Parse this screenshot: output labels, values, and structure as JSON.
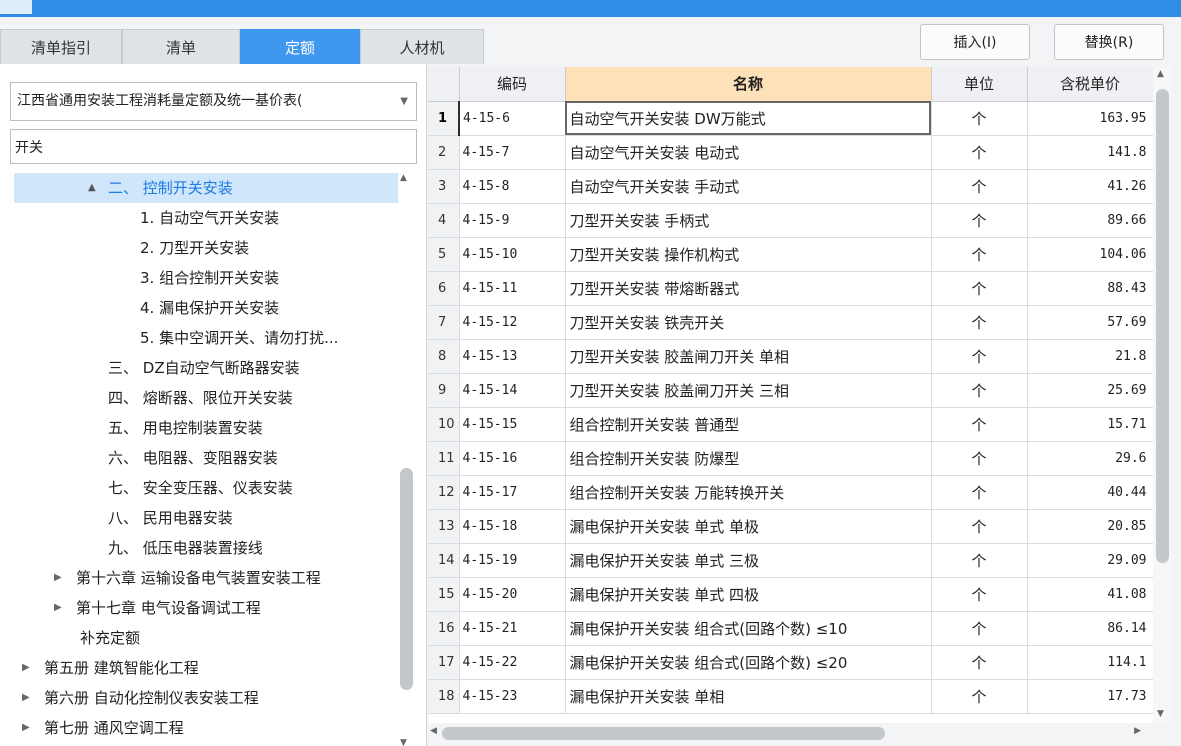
{
  "tabs": [
    "清单指引",
    "清单",
    "定额",
    "人材机"
  ],
  "active_tab": "定额",
  "toolbar": {
    "insert_label": "插入(I)",
    "replace_label": "替换(R)"
  },
  "library_select": "江西省通用安装工程消耗量定额及统一基价表(",
  "search_value": "开关",
  "tree": [
    {
      "label": "二、 控制开关安装",
      "arrow": "▲",
      "selected": true
    },
    {
      "label": "1. 自动空气开关安装"
    },
    {
      "label": "2. 刀型开关安装"
    },
    {
      "label": "3. 组合控制开关安装"
    },
    {
      "label": "4. 漏电保护开关安装"
    },
    {
      "label": "5. 集中空调开关、请勿打扰..."
    },
    {
      "label": "三、 DZ自动空气断路器安装"
    },
    {
      "label": "四、 熔断器、限位开关安装"
    },
    {
      "label": "五、 用电控制装置安装"
    },
    {
      "label": "六、 电阻器、变阻器安装"
    },
    {
      "label": "七、 安全变压器、仪表安装"
    },
    {
      "label": "八、 民用电器安装"
    },
    {
      "label": "九、 低压电器装置接线"
    },
    {
      "label": "第十六章 运输设备电气装置安装工程",
      "arrow": "▶"
    },
    {
      "label": "第十七章 电气设备调试工程",
      "arrow": "▶"
    },
    {
      "label": "补充定额"
    },
    {
      "label": "第五册 建筑智能化工程",
      "arrow": "▶"
    },
    {
      "label": "第六册 自动化控制仪表安装工程",
      "arrow": "▶"
    },
    {
      "label": "第七册 通风空调工程",
      "arrow": "▶"
    }
  ],
  "table": {
    "headers": [
      "",
      "编码",
      "名称",
      "单位",
      "含税单价"
    ],
    "rows": [
      [
        "1",
        "4-15-6",
        "自动空气开关安装 DW万能式",
        "个",
        "163.95"
      ],
      [
        "2",
        "4-15-7",
        "自动空气开关安装 电动式",
        "个",
        "141.8"
      ],
      [
        "3",
        "4-15-8",
        "自动空气开关安装 手动式",
        "个",
        "41.26"
      ],
      [
        "4",
        "4-15-9",
        "刀型开关安装 手柄式",
        "个",
        "89.66"
      ],
      [
        "5",
        "4-15-10",
        "刀型开关安装 操作机构式",
        "个",
        "104.06"
      ],
      [
        "6",
        "4-15-11",
        "刀型开关安装 带熔断器式",
        "个",
        "88.43"
      ],
      [
        "7",
        "4-15-12",
        "刀型开关安装 铁壳开关",
        "个",
        "57.69"
      ],
      [
        "8",
        "4-15-13",
        "刀型开关安装 胶盖闸刀开关 单相",
        "个",
        "21.8"
      ],
      [
        "9",
        "4-15-14",
        "刀型开关安装 胶盖闸刀开关 三相",
        "个",
        "25.69"
      ],
      [
        "10",
        "4-15-15",
        "组合控制开关安装 普通型",
        "个",
        "15.71"
      ],
      [
        "11",
        "4-15-16",
        "组合控制开关安装 防爆型",
        "个",
        "29.6"
      ],
      [
        "12",
        "4-15-17",
        "组合控制开关安装 万能转换开关",
        "个",
        "40.44"
      ],
      [
        "13",
        "4-15-18",
        "漏电保护开关安装 单式 单极",
        "个",
        "20.85"
      ],
      [
        "14",
        "4-15-19",
        "漏电保护开关安装 单式 三极",
        "个",
        "29.09"
      ],
      [
        "15",
        "4-15-20",
        "漏电保护开关安装 单式 四极",
        "个",
        "41.08"
      ],
      [
        "16",
        "4-15-21",
        "漏电保护开关安装 组合式(回路个数) ≤10",
        "个",
        "86.14"
      ],
      [
        "17",
        "4-15-22",
        "漏电保护开关安装 组合式(回路个数) ≤20",
        "个",
        "114.1"
      ],
      [
        "18",
        "4-15-23",
        "漏电保护开关安装 单相",
        "个",
        "17.73"
      ]
    ]
  },
  "icons": {
    "dropdown": "chevron-down-icon",
    "expand": "triangle-right-icon",
    "collapse": "triangle-up-icon",
    "scroll_up": "chevron-up-icon",
    "scroll_down": "chevron-down-icon",
    "scroll_left": "chevron-left-icon",
    "scroll_right": "chevron-right-icon"
  },
  "colors": {
    "accent": "#3f97ef",
    "title_bar": "#2f8de6",
    "selected_tree": "#cfe6fb",
    "name_header": "#fde1b8"
  }
}
